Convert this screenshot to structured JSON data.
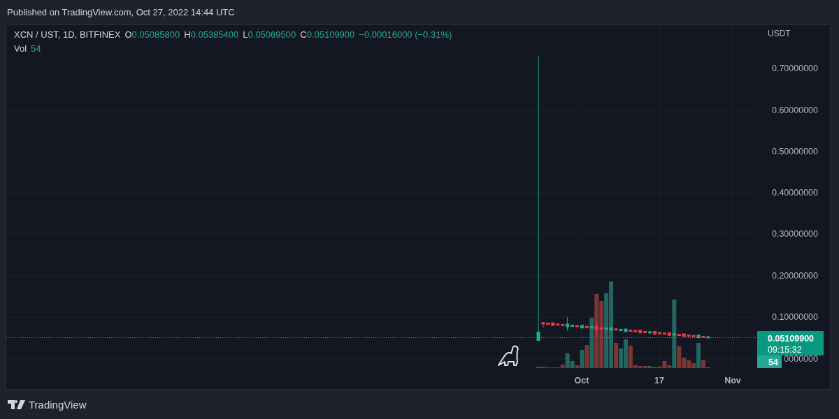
{
  "header": {
    "text": "Published on TradingView.com, Oct 27, 2022 14:44 UTC"
  },
  "legend": {
    "symbol": "XCN / UST, 1D, BITFINEX",
    "ohlc": [
      {
        "label": "O",
        "value": "0.05085800"
      },
      {
        "label": "H",
        "value": "0.05385400"
      },
      {
        "label": "L",
        "value": "0.05069500"
      },
      {
        "label": "C",
        "value": "0.05109900"
      }
    ],
    "change": "−0.00016000 (−0.31%)",
    "volume": {
      "label": "Vol",
      "value": "54"
    }
  },
  "price_axis": {
    "currency": "USDT",
    "labels": [
      "0.70000000",
      "0.60000000",
      "0.50000000",
      "0.40000000",
      "0.30000000",
      "0.20000000",
      "0.10000000",
      "0000000"
    ],
    "last_price": "0.05109900",
    "countdown": "09:15:32",
    "volume_badge": "54"
  },
  "time_axis": {
    "labels": [
      "Oct",
      "17",
      "Nov"
    ]
  },
  "footer": {
    "brand": "TradingView"
  }
}
